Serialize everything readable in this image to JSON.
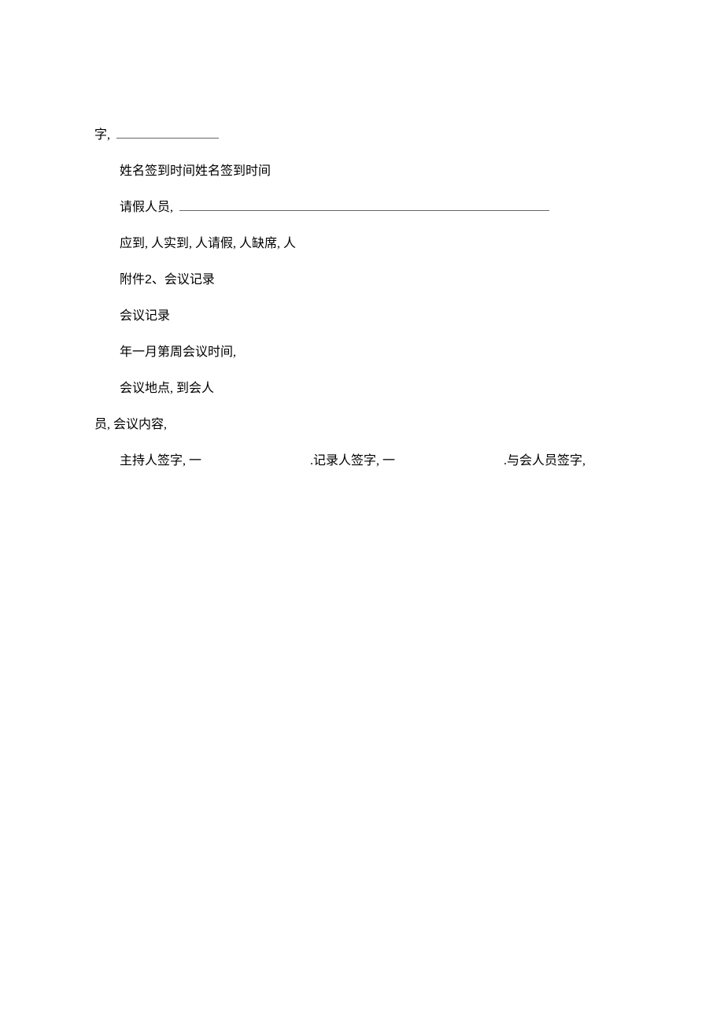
{
  "line1_prefix": "字,",
  "line2": "姓名签到时间姓名签到时间",
  "line3_prefix": "请假人员,",
  "line4": "应到, 人实到, 人请假, 人缺席, 人",
  "line5_a": "附件",
  "line5_num": "2",
  "line5_b": "、会议记录",
  "line6": "会议记录",
  "line7": "年一月第周会议时间,",
  "line8": "会议地点, 到会人",
  "line9": "员, 会议内容,",
  "sig1": "主持人签字, 一",
  "sig_dot": " . ",
  "sig2": "记录人签字, 一",
  "sig3": "与会人员签字,"
}
